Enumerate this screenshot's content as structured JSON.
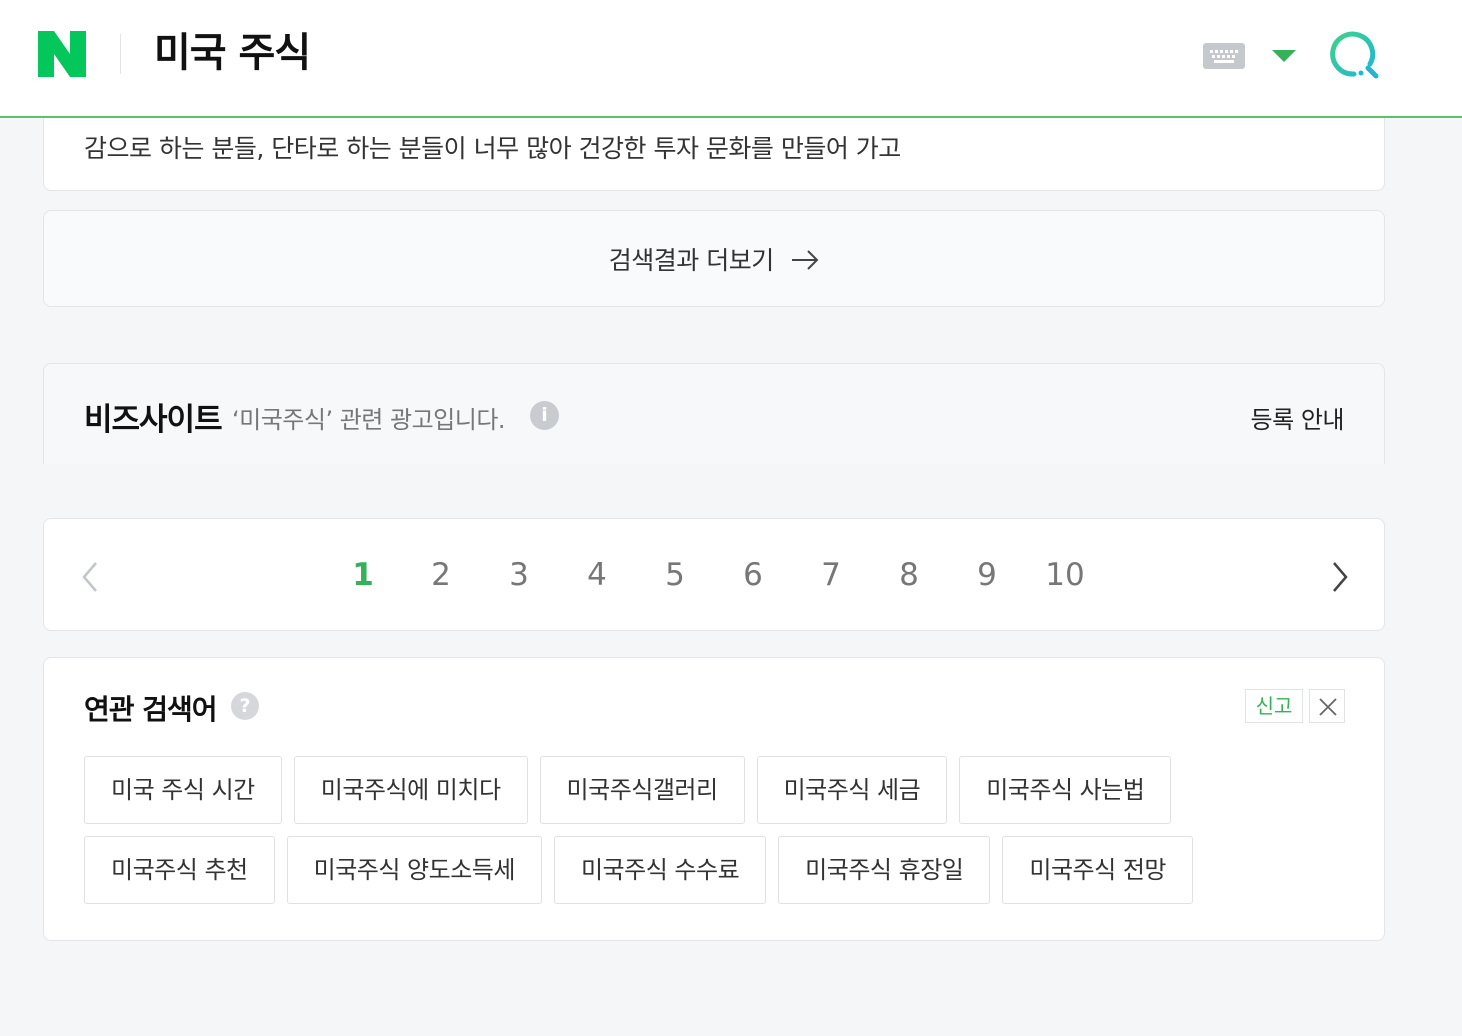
{
  "header": {
    "query": "미국 주식",
    "brand_color": "#03c75a"
  },
  "snippet": {
    "text": "감으로 하는 분들, 단타로 하는 분들이 너무 많아 건강한 투자 문화를 만들어 가고"
  },
  "more_results": {
    "label": "검색결과 더보기",
    "arrow": "→"
  },
  "bizsite": {
    "title": "비즈사이트",
    "description": "‘미국주식’ 관련 광고입니다.",
    "info": "i",
    "register_label": "등록 안내"
  },
  "pagination": {
    "current": 1,
    "pages": [
      "1",
      "2",
      "3",
      "4",
      "5",
      "6",
      "7",
      "8",
      "9",
      "10"
    ]
  },
  "related": {
    "title": "연관 검색어",
    "help": "?",
    "report_label": "신고",
    "row1": [
      "미국 주식 시간",
      "미국주식에 미치다",
      "미국주식갤러리",
      "미국주식 세금",
      "미국주식 사는법"
    ],
    "row2": [
      "미국주식 추천",
      "미국주식 양도소득세",
      "미국주식 수수료",
      "미국주식 휴장일",
      "미국주식 전망"
    ]
  }
}
